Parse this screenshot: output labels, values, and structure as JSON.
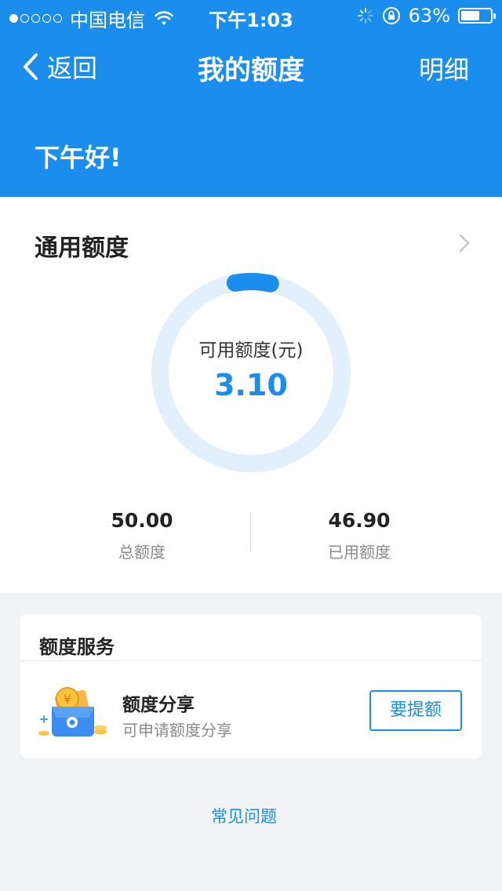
{
  "status_bar": {
    "carrier": "中国电信",
    "time": "下午1:03",
    "battery_percent": "63%",
    "battery_level": 0.63,
    "signal_bars_filled": 1,
    "signal_bars_total": 5
  },
  "nav": {
    "back_label": "返回",
    "title": "我的额度",
    "right_label": "明细"
  },
  "greeting": "下午好!",
  "quota": {
    "section_title": "通用额度",
    "available_label": "可用额度(元)",
    "available_value": "3.10",
    "available_fraction": 0.062,
    "total_value": "50.00",
    "total_label": "总额度",
    "used_value": "46.90",
    "used_label": "已用额度"
  },
  "service": {
    "section_title": "额度服务",
    "item_name": "额度分享",
    "item_desc": "可申请额度分享",
    "button_label": "要提额",
    "icon": "wallet-coin-icon"
  },
  "faq_link": "常见问题",
  "colors": {
    "accent": "#1a8ded",
    "ring_track": "#e2f0fd",
    "page_bg": "#f2f3f7"
  }
}
